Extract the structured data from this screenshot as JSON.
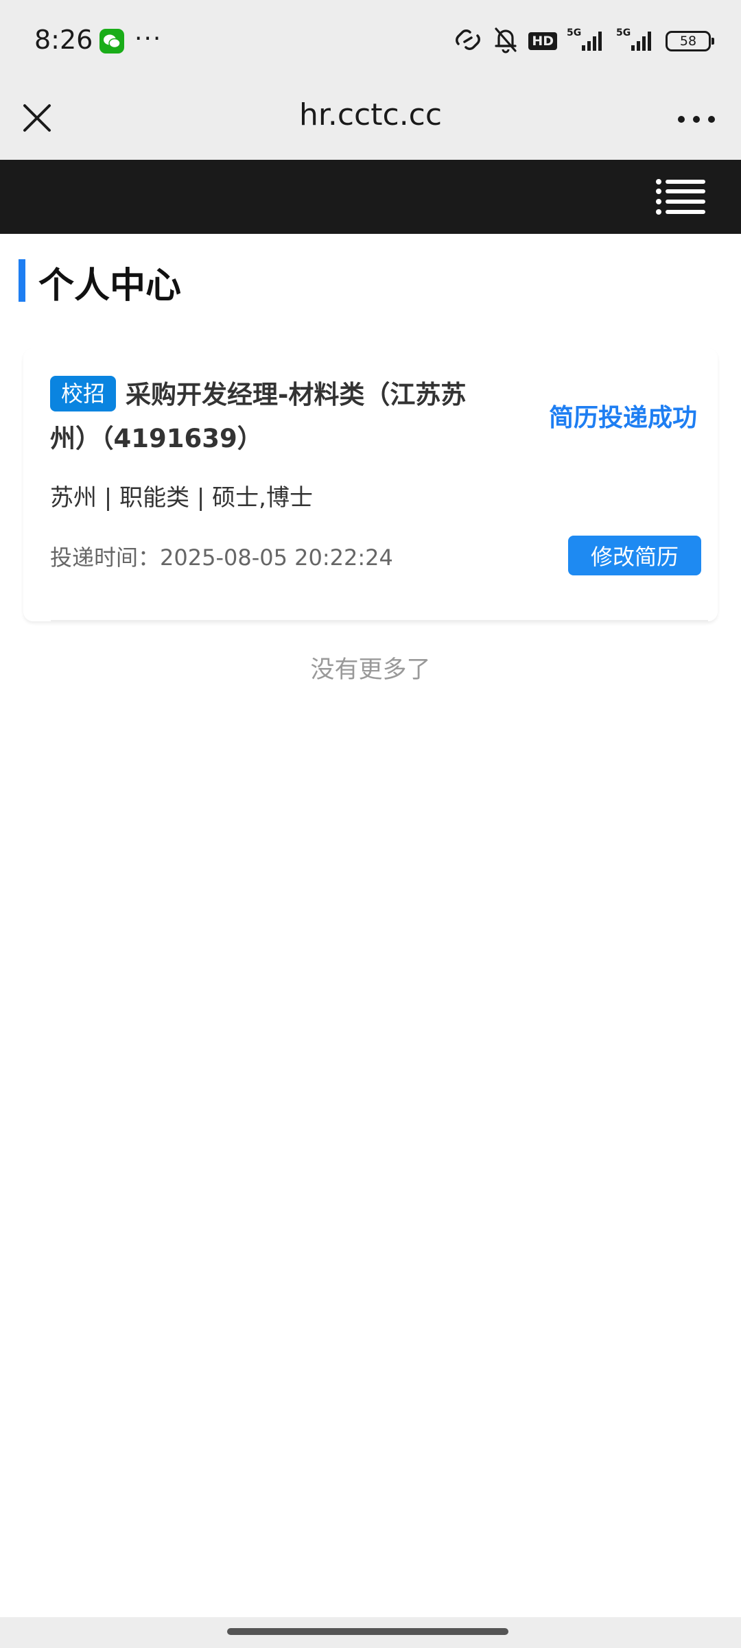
{
  "status_bar": {
    "time": "8:26",
    "more_indicator": "···",
    "network_badge": "HD",
    "battery_level": "58",
    "icons": [
      "wechat-icon",
      "link-icon",
      "bell-muted-icon",
      "hd-icon",
      "signal-5g-icon",
      "signal-5g-icon",
      "battery-icon"
    ]
  },
  "browser": {
    "title": "hr.cctc.cc",
    "icons": [
      "close-icon",
      "more-horizontal-icon"
    ]
  },
  "nav": {
    "icons": [
      "menu-list-icon"
    ]
  },
  "page": {
    "title": "个人中心",
    "accent_color": "#1e7ef2"
  },
  "application": {
    "tag": "校招",
    "job_title": "采购开发经理-材料类（江苏苏州）（4191639）",
    "status": "简历投递成功",
    "meta": "苏州 | 职能类 | 硕士,博士",
    "submit_time": "投递时间：2025-08-05 20:22:24",
    "edit_button": "修改简历"
  },
  "list_end_text": "没有更多了"
}
